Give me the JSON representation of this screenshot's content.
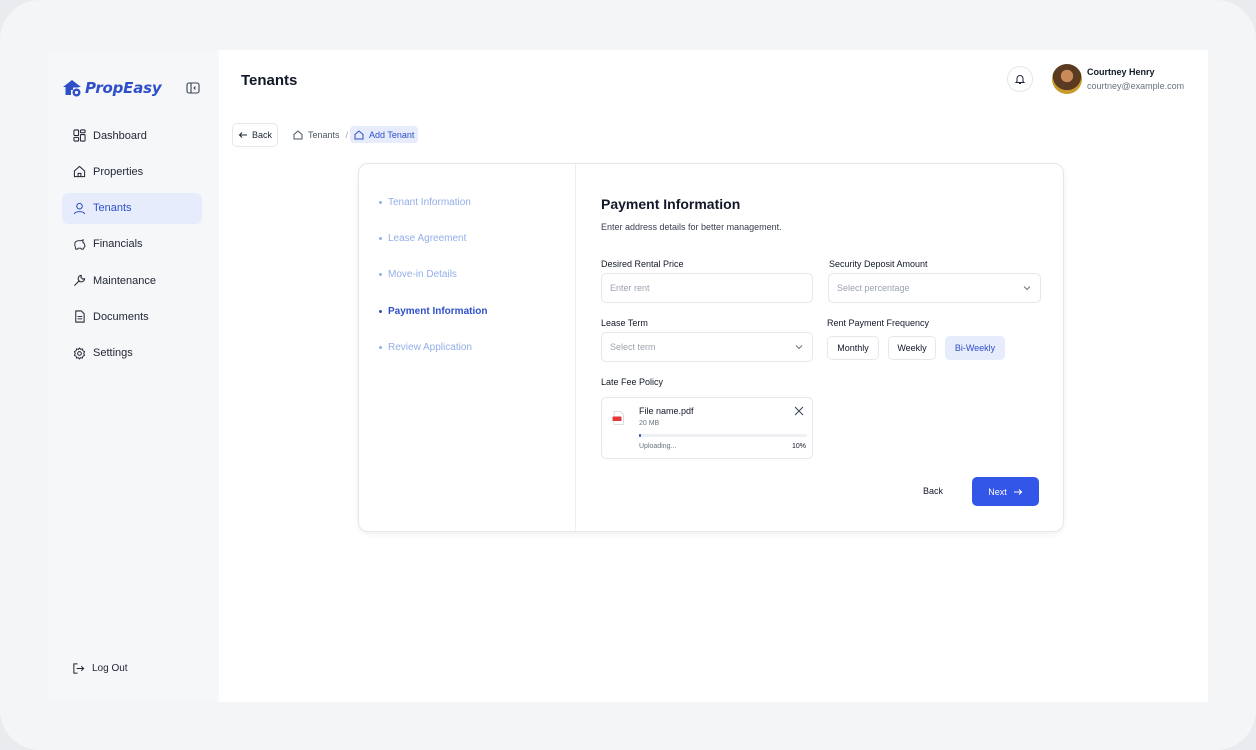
{
  "app": {
    "name": "PropEasy",
    "brand_color": "#2f4fc9"
  },
  "sidebar": {
    "items": [
      {
        "label": "Dashboard",
        "icon": "dashboard-icon"
      },
      {
        "label": "Properties",
        "icon": "home-icon"
      },
      {
        "label": "Tenants",
        "icon": "user-icon",
        "active": true
      },
      {
        "label": "Financials",
        "icon": "piggy-bank-icon"
      },
      {
        "label": "Maintenance",
        "icon": "wrench-icon"
      },
      {
        "label": "Documents",
        "icon": "document-icon"
      },
      {
        "label": "Settings",
        "icon": "gear-icon"
      }
    ],
    "logout_label": "Log Out"
  },
  "header": {
    "title": "Tenants",
    "user": {
      "name": "Courtney Henry",
      "email": "courtney@example.com"
    }
  },
  "nav": {
    "back_label": "Back",
    "breadcrumb": [
      {
        "label": "Tenants"
      },
      {
        "label": "Add Tenant",
        "current": true
      }
    ]
  },
  "steps": [
    {
      "label": "Tenant Information"
    },
    {
      "label": "Lease Agreement"
    },
    {
      "label": "Move-in Details"
    },
    {
      "label": "Payment Information",
      "active": true
    },
    {
      "label": "Review Application"
    }
  ],
  "form": {
    "title": "Payment Information",
    "subtitle": "Enter address details for better management.",
    "rental_price": {
      "label": "Desired Rental Price",
      "placeholder": "Enter rent",
      "value": ""
    },
    "security_deposit": {
      "label": "Security Deposit Amount",
      "placeholder": "Select percentage"
    },
    "lease_term": {
      "label": "Lease Term",
      "placeholder": "Select term"
    },
    "payment_frequency": {
      "label": "Rent Payment Frequency",
      "options": [
        "Monthly",
        "Weekly",
        "Bi-Weekly"
      ],
      "selected": "Bi-Weekly"
    },
    "late_fee": {
      "label": "Late Fee Policy",
      "file": {
        "name": "File name.pdf",
        "size": "20 MB",
        "status": "Uploading...",
        "progress_label": "10%",
        "progress": 0.1
      }
    },
    "back_label": "Back",
    "next_label": "Next"
  }
}
